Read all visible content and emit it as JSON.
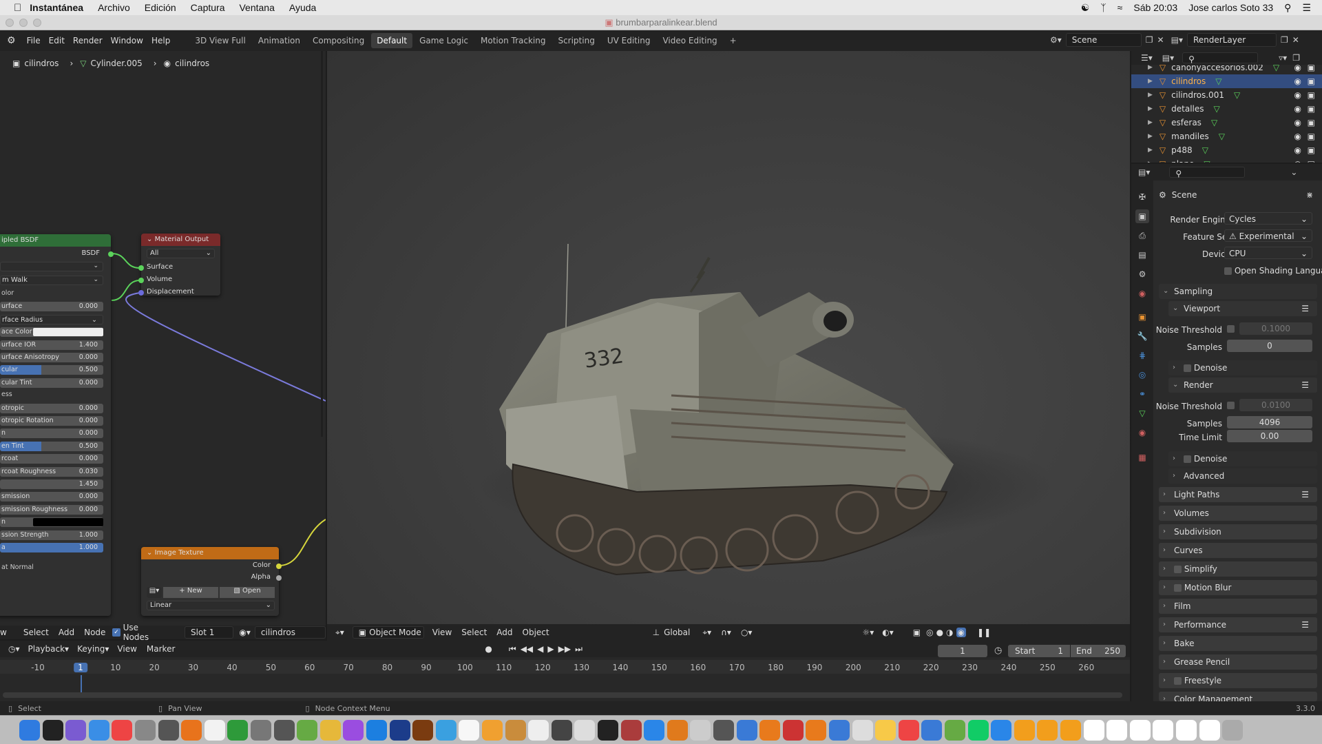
{
  "mac": {
    "app_name": "Instantánea",
    "menus": [
      "Archivo",
      "Edición",
      "Captura",
      "Ventana",
      "Ayuda"
    ],
    "clock": "Sáb 20:03",
    "user": "Jose carlos Soto 33"
  },
  "window": {
    "title": "brumbarparalinkear.blend"
  },
  "topbar": {
    "menus": [
      "File",
      "Edit",
      "Render",
      "Window",
      "Help"
    ],
    "workspaces": [
      "3D View Full",
      "Animation",
      "Compositing",
      "Default",
      "Game Logic",
      "Motion Tracking",
      "Scripting",
      "UV Editing",
      "Video Editing"
    ],
    "active_workspace": "Default",
    "add": "+",
    "scene": "Scene",
    "view_layer": "RenderLayer"
  },
  "node_editor": {
    "breadcrumb": [
      "cilindros",
      "Cylinder.005",
      "cilindros"
    ],
    "bsdf": {
      "title": "ipled BSDF",
      "output": "BSDF",
      "dropdown2": "m Walk",
      "rows": [
        {
          "label": "olor",
          "value": "",
          "kind": "label"
        },
        {
          "label": "urface",
          "value": "0.000",
          "kind": "field"
        },
        {
          "label": "rface Radius",
          "value": "",
          "kind": "dropdown"
        },
        {
          "label": "ace Color",
          "value": "",
          "kind": "color"
        },
        {
          "label": "urface IOR",
          "value": "1.400",
          "kind": "field"
        },
        {
          "label": "urface Anisotropy",
          "value": "0.000",
          "kind": "field"
        },
        {
          "label": "cular",
          "value": "0.500",
          "kind": "slider"
        },
        {
          "label": "cular Tint",
          "value": "0.000",
          "kind": "field"
        },
        {
          "label": "ess",
          "value": "",
          "kind": "label"
        },
        {
          "label": "otropic",
          "value": "0.000",
          "kind": "field"
        },
        {
          "label": "otropic Rotation",
          "value": "0.000",
          "kind": "field"
        },
        {
          "label": "n",
          "value": "0.000",
          "kind": "field"
        },
        {
          "label": "en Tint",
          "value": "0.500",
          "kind": "slider"
        },
        {
          "label": "rcoat",
          "value": "0.000",
          "kind": "field"
        },
        {
          "label": "rcoat Roughness",
          "value": "0.030",
          "kind": "field"
        },
        {
          "label": "",
          "value": "1.450",
          "kind": "field"
        },
        {
          "label": "smission",
          "value": "0.000",
          "kind": "field"
        },
        {
          "label": "smission Roughness",
          "value": "0.000",
          "kind": "field"
        },
        {
          "label": "n",
          "value": "",
          "kind": "black"
        },
        {
          "label": "ssion Strength",
          "value": "1.000",
          "kind": "field"
        },
        {
          "label": "a",
          "value": "1.000",
          "kind": "fullslider"
        }
      ],
      "normal": "at Normal"
    },
    "material_output": {
      "title": "Material Output",
      "target": "All",
      "inputs": [
        "Surface",
        "Volume",
        "Displacement"
      ]
    },
    "image_texture": {
      "title": "Image Texture",
      "outputs": [
        "Color",
        "Alpha"
      ],
      "new_label": "New",
      "open_label": "Open",
      "interp": "Linear"
    },
    "footer": {
      "menus": [
        "w",
        "Select",
        "Add",
        "Node"
      ],
      "use_nodes": "Use Nodes",
      "slot": "Slot 1",
      "material": "cilindros"
    }
  },
  "viewport": {
    "mode": "Object Mode",
    "menus": [
      "View",
      "Select",
      "Add",
      "Object"
    ],
    "orientation": "Global",
    "tank_number": "332"
  },
  "outliner": {
    "items": [
      {
        "name": "cañonyaccesorios.002",
        "selected": false
      },
      {
        "name": "cilindros",
        "selected": true
      },
      {
        "name": "cilindros.001",
        "selected": false
      },
      {
        "name": "detalles",
        "selected": false
      },
      {
        "name": "esferas",
        "selected": false
      },
      {
        "name": "mandiles",
        "selected": false
      },
      {
        "name": "p488",
        "selected": false
      },
      {
        "name": "plano",
        "selected": false
      }
    ]
  },
  "properties": {
    "context": "Scene",
    "render_engine_label": "Render Engine",
    "render_engine": "Cycles",
    "feature_set_label": "Feature Set",
    "feature_set": "Experimental",
    "device_label": "Device",
    "device": "CPU",
    "osl": "Open Shading Langua...",
    "sampling": "Sampling",
    "viewport": "Viewport",
    "noise_threshold_label": "Noise Threshold",
    "viewport_noise": "0.1000",
    "samples_label": "Samples",
    "viewport_samples": "0",
    "denoise": "Denoise",
    "render": "Render",
    "render_noise": "0.0100",
    "render_samples": "4096",
    "time_limit_label": "Time Limit",
    "time_limit": "0.00",
    "advanced": "Advanced",
    "panels": [
      "Light Paths",
      "Volumes",
      "Subdivision",
      "Curves",
      "Simplify",
      "Motion Blur",
      "Film",
      "Performance",
      "Bake",
      "Grease Pencil",
      "Freestyle",
      "Color Management"
    ]
  },
  "timeline": {
    "menus": [
      "Playback",
      "Keying",
      "View",
      "Marker"
    ],
    "current_frame": "1",
    "start_label": "Start",
    "start": "1",
    "end_label": "End",
    "end": "250",
    "ticks": [
      "-10",
      "1",
      "10",
      "20",
      "30",
      "40",
      "50",
      "60",
      "70",
      "80",
      "90",
      "100",
      "110",
      "120",
      "130",
      "140",
      "150",
      "160",
      "170",
      "180",
      "190",
      "200",
      "210",
      "220",
      "230",
      "240",
      "250",
      "260"
    ]
  },
  "status": {
    "select": "Select",
    "pan": "Pan View",
    "context": "Node Context Menu",
    "version": "3.3.0"
  },
  "colors": {
    "accent": "#4772b3",
    "selected_row": "#334d80",
    "bsdf_header": "#2f6e38",
    "output_header": "#7a2a2a",
    "texture_header": "#c06b16"
  }
}
